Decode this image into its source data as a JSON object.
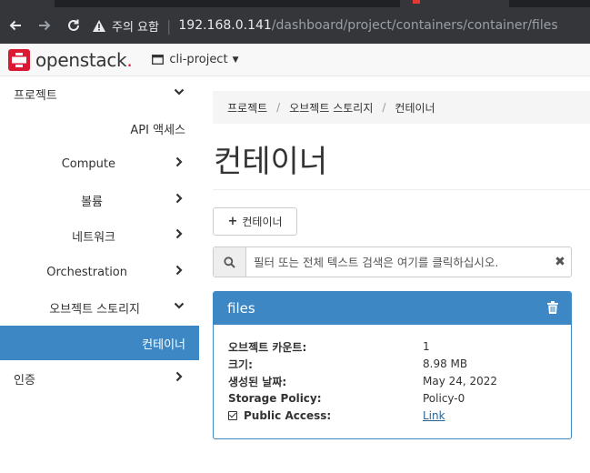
{
  "browser": {
    "security_label": "주의 요함",
    "url_host": "192.168.0.141",
    "url_path": "/dashboard/project/containers/container/files"
  },
  "header": {
    "logo_text": "openstack",
    "logo_dot": ".",
    "project": "cli-project"
  },
  "sidebar": {
    "items": [
      {
        "label": "프로젝트",
        "chevron": "down"
      },
      {
        "label": "API 액세스",
        "chevron": ""
      },
      {
        "label": "Compute",
        "chevron": "right"
      },
      {
        "label": "볼륨",
        "chevron": "right"
      },
      {
        "label": "네트워크",
        "chevron": "right"
      },
      {
        "label": "Orchestration",
        "chevron": "right"
      },
      {
        "label": "오브젝트 스토리지",
        "chevron": "down"
      },
      {
        "label": "컨테이너",
        "chevron": "",
        "active": true
      },
      {
        "label": "인증",
        "chevron": "right"
      }
    ]
  },
  "breadcrumb": [
    "프로젝트",
    "오브젝트 스토리지",
    "컨테이너"
  ],
  "main": {
    "title": "컨테이너",
    "add_button": "컨테이너",
    "search_placeholder": "필터 또는 전체 텍스트 검색은 여기를 클릭하십시오."
  },
  "container": {
    "name": "files",
    "details": [
      {
        "key": "오브젝트 카운트:",
        "value": "1"
      },
      {
        "key": "크기:",
        "value": "8.98 MB"
      },
      {
        "key": "생성된 날짜:",
        "value": "May 24, 2022"
      },
      {
        "key": "Storage Policy:",
        "value": "Policy-0"
      },
      {
        "key": "Public Access:",
        "value": "Link",
        "checked": true,
        "is_link": true
      }
    ]
  },
  "colors": {
    "accent": "#3d88c4",
    "brand_red": "#da1a32",
    "chrome_dark": "#35363a"
  }
}
